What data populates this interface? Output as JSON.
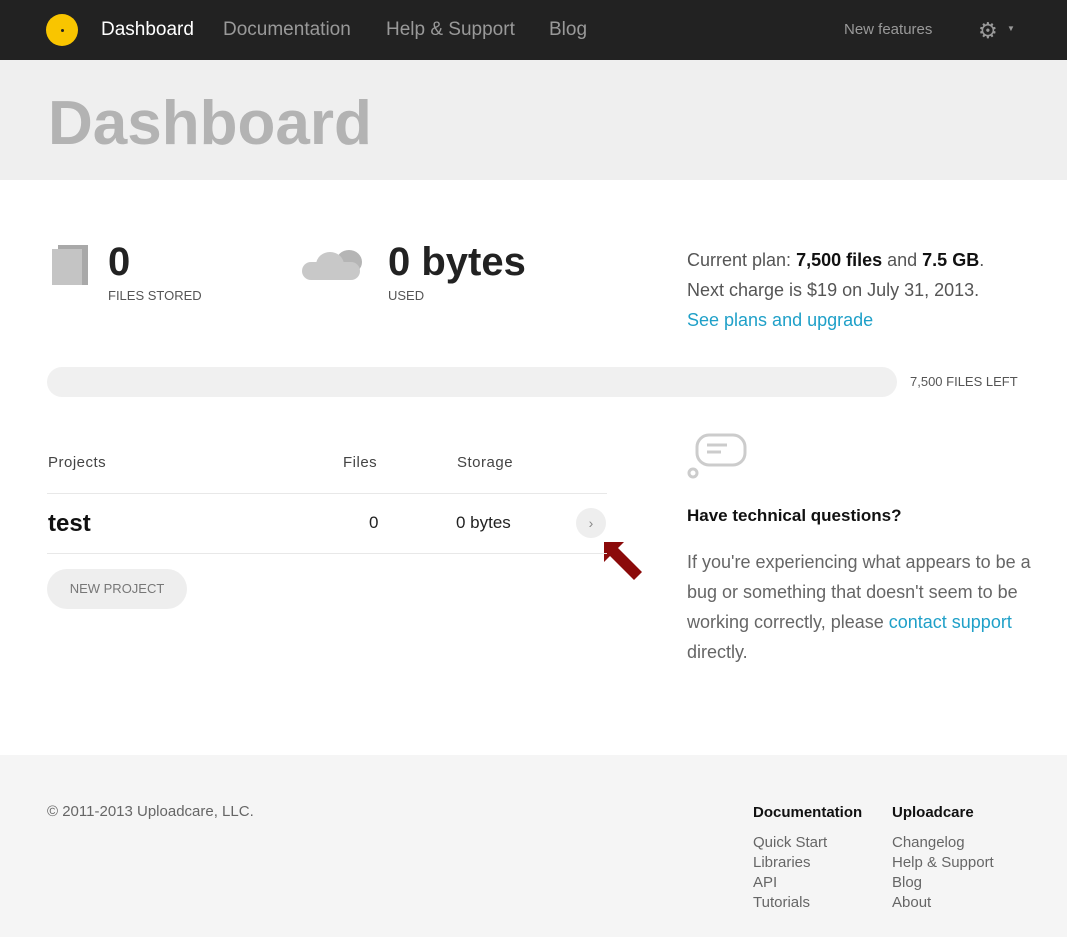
{
  "nav": {
    "items": [
      "Dashboard",
      "Documentation",
      "Help & Support",
      "Blog"
    ],
    "new_features": "New features"
  },
  "hero": {
    "title": "Dashboard"
  },
  "stats": {
    "files_value": "0",
    "files_label": "FILES STORED",
    "used_value": "0 bytes",
    "used_label": "USED"
  },
  "plan": {
    "prefix": "Current plan: ",
    "files": "7,500 files",
    "and": " and ",
    "size": "7.5 GB",
    "suffix": ".",
    "next_charge": "Next charge is $19 on July 31, 2013.",
    "upgrade_link": "See plans and upgrade"
  },
  "usage": {
    "fraction_used": 0,
    "files_left": "7,500 FILES LEFT"
  },
  "projects": {
    "headers": [
      "Projects",
      "Files",
      "Storage"
    ],
    "rows": [
      {
        "name": "test",
        "files": "0",
        "storage": "0 bytes"
      }
    ],
    "new_button": "NEW PROJECT"
  },
  "support": {
    "title": "Have technical questions?",
    "text": "If you're experiencing what appears to be a bug or something that doesn't seem to be working correctly, please ",
    "link": "contact support",
    "after": " directly."
  },
  "footer": {
    "copyright": "© 2011-2013 Uploadcare, LLC.",
    "columns": [
      {
        "title": "Documentation",
        "links": [
          "Quick Start",
          "Libraries",
          "API",
          "Tutorials"
        ]
      },
      {
        "title": "Uploadcare",
        "links": [
          "Changelog",
          "Help & Support",
          "Blog",
          "About"
        ]
      }
    ]
  },
  "colors": {
    "accent": "#1fa0c8",
    "logo": "#f9c500",
    "arrow": "#8b0a0a"
  }
}
